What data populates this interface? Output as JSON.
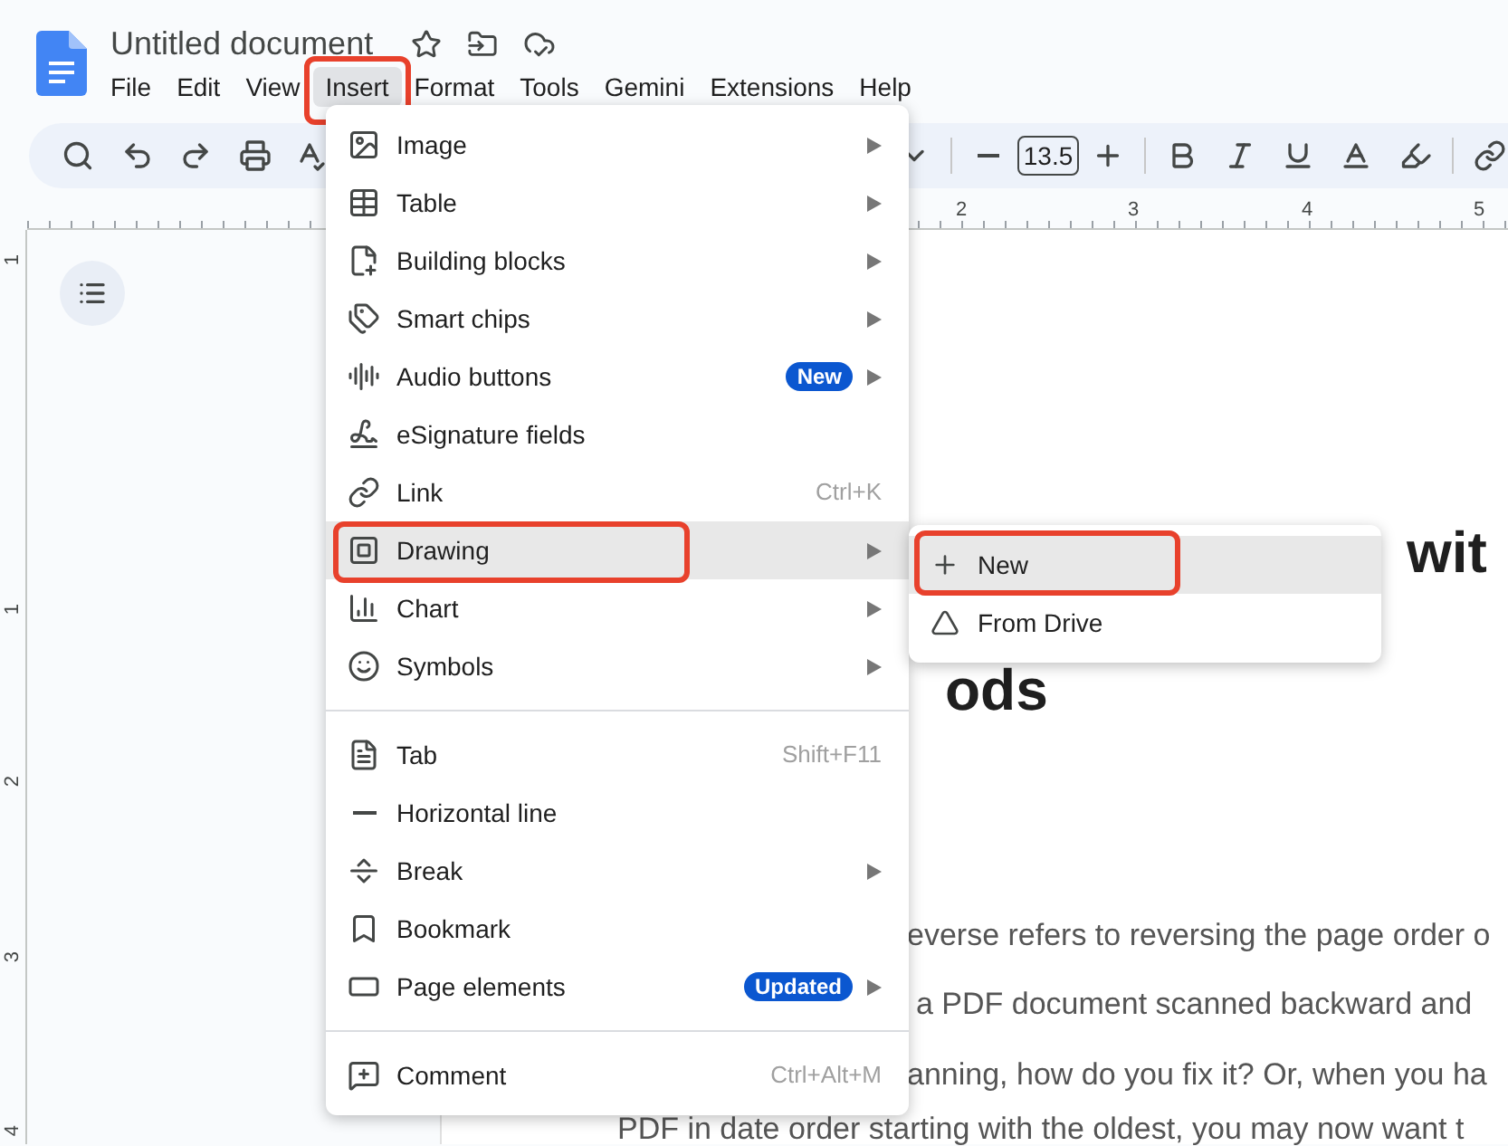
{
  "document": {
    "title": "Untitled document"
  },
  "menu_bar": [
    {
      "label": "File",
      "selected": false,
      "annotated": false
    },
    {
      "label": "Edit",
      "selected": false,
      "annotated": false
    },
    {
      "label": "View",
      "selected": false,
      "annotated": false
    },
    {
      "label": "Insert",
      "selected": true,
      "annotated": true
    },
    {
      "label": "Format",
      "selected": false,
      "annotated": false
    },
    {
      "label": "Tools",
      "selected": false,
      "annotated": false
    },
    {
      "label": "Gemini",
      "selected": false,
      "annotated": false
    },
    {
      "label": "Extensions",
      "selected": false,
      "annotated": false
    },
    {
      "label": "Help",
      "selected": false,
      "annotated": false
    }
  ],
  "toolbar": {
    "font_size": "13.5"
  },
  "ruler": {
    "marks": [
      "2",
      "3",
      "4",
      "5"
    ]
  },
  "vertical_ruler": {
    "marks": [
      "1",
      "1",
      "2",
      "3",
      "4"
    ]
  },
  "page": {
    "heading_lines": [
      "wit",
      "ods"
    ],
    "body_lines": [
      "everse refers to reversing the page order o",
      "a PDF document scanned backward and",
      "anning, how do you fix it? Or, when you ha",
      "PDF in date order starting with the oldest, you may now want t"
    ]
  },
  "insert_menu": {
    "sections": [
      [
        {
          "label": "Image",
          "submenu": true,
          "selected": false,
          "annotated": false
        },
        {
          "label": "Table",
          "submenu": true,
          "selected": false,
          "annotated": false
        },
        {
          "label": "Building blocks",
          "submenu": true,
          "selected": false,
          "annotated": false
        },
        {
          "label": "Smart chips",
          "submenu": true,
          "selected": false,
          "annotated": false
        },
        {
          "label": "Audio buttons",
          "badge": "New",
          "submenu": true,
          "selected": false,
          "annotated": false
        },
        {
          "label": "eSignature fields",
          "submenu": false,
          "selected": false,
          "annotated": false
        },
        {
          "label": "Link",
          "shortcut": "Ctrl+K",
          "submenu": false,
          "selected": false,
          "annotated": false
        },
        {
          "label": "Drawing",
          "submenu": true,
          "selected": true,
          "annotated": true
        },
        {
          "label": "Chart",
          "submenu": true,
          "selected": false,
          "annotated": false
        },
        {
          "label": "Symbols",
          "submenu": true,
          "selected": false,
          "annotated": false
        }
      ],
      [
        {
          "label": "Tab",
          "shortcut": "Shift+F11",
          "submenu": false,
          "selected": false,
          "annotated": false
        },
        {
          "label": "Horizontal line",
          "submenu": false,
          "selected": false,
          "annotated": false
        },
        {
          "label": "Break",
          "submenu": true,
          "selected": false,
          "annotated": false
        },
        {
          "label": "Bookmark",
          "submenu": false,
          "selected": false,
          "annotated": false
        },
        {
          "label": "Page elements",
          "badge": "Updated",
          "submenu": true,
          "selected": false,
          "annotated": false
        }
      ],
      [
        {
          "label": "Comment",
          "shortcut": "Ctrl+Alt+M",
          "submenu": false,
          "selected": false,
          "annotated": false
        }
      ]
    ]
  },
  "drawing_submenu": [
    {
      "label": "New",
      "selected": true,
      "annotated": true
    },
    {
      "label": "From Drive",
      "selected": false,
      "annotated": false
    }
  ]
}
